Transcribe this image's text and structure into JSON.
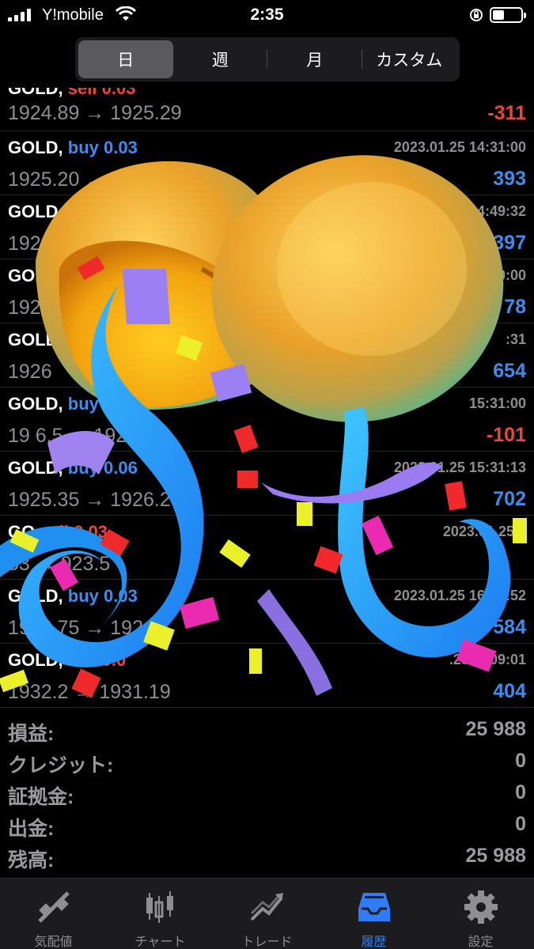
{
  "status_bar": {
    "carrier": "Y!mobile",
    "time": "2:35"
  },
  "periods": [
    {
      "label": "日",
      "active": true
    },
    {
      "label": "週",
      "active": false
    },
    {
      "label": "月",
      "active": false
    },
    {
      "label": "カスタム",
      "active": false
    }
  ],
  "deals": [
    {
      "symbol": "GOLD,",
      "side": "sell",
      "volume": "0.03",
      "time": "",
      "open_price": "1924.89",
      "close_price": "1925.29",
      "arrow": "→",
      "profit": "-311"
    },
    {
      "symbol": "GOLD,",
      "side": "buy",
      "volume": "0.03",
      "time": "2023.01.25 14:31:00",
      "open_price": "1925.20",
      "close_price": "",
      "arrow": "→",
      "profit": "393"
    },
    {
      "symbol": "GOLD,",
      "side": "",
      "volume": "",
      "time": "14:49:32",
      "open_price": "192",
      "close_price": "",
      "arrow": "",
      "profit": "397"
    },
    {
      "symbol": "GOL",
      "side": "",
      "volume": "",
      "time": "0:00",
      "open_price": "192",
      "close_price": "",
      "arrow": "",
      "profit": "78"
    },
    {
      "symbol": "GOLD",
      "side": "",
      "volume": "",
      "time": ":31",
      "open_price": "1926",
      "close_price": "",
      "arrow": "",
      "profit": "654"
    },
    {
      "symbol": "GOLD,",
      "side": "buy",
      "volume": "",
      "time": "15:31:00",
      "open_price": "19 6.5",
      "close_price": "1926.25",
      "arrow": "→",
      "profit": "-101"
    },
    {
      "symbol": "GOLD,",
      "side": "buy",
      "volume": "0.06",
      "time": "2023.01.25 15:31:13",
      "open_price": "1925.35",
      "close_price": "1926.2",
      "arrow": "→",
      "profit": "702"
    },
    {
      "symbol": "GO",
      "side": "sell",
      "volume": "0.03",
      "time": "2023.01.25 1",
      "open_price": "53",
      "close_price": "923.5",
      "arrow": "→",
      "profit": ""
    },
    {
      "symbol": "GOLD,",
      "side": "buy",
      "volume": "0.03",
      "time": "2023.01.25 16:15:52",
      "open_price": "1926.75",
      "close_price": "192",
      "arrow": "→",
      "profit": "584"
    },
    {
      "symbol": "GOLD,",
      "side": "sell",
      "volume": "0.0",
      "time": ".25 1 :09:01",
      "open_price": "1932.2",
      "close_price": "1931.19",
      "arrow": "→",
      "profit": "404"
    }
  ],
  "summary": [
    {
      "label": "損益:",
      "value": "25 988"
    },
    {
      "label": "クレジット:",
      "value": "0"
    },
    {
      "label": "証拠金:",
      "value": "0"
    },
    {
      "label": "出金:",
      "value": "0"
    },
    {
      "label": "残高:",
      "value": "25 988"
    }
  ],
  "tabs": [
    {
      "label": "気配値",
      "icon": "quotes-icon",
      "active": false
    },
    {
      "label": "チャート",
      "icon": "chart-icon",
      "active": false
    },
    {
      "label": "トレード",
      "icon": "trade-icon",
      "active": false
    },
    {
      "label": "履歴",
      "icon": "history-icon",
      "active": true
    },
    {
      "label": "設定",
      "icon": "settings-icon",
      "active": false
    }
  ],
  "colors": {
    "buy": "#3b8df0",
    "sell": "#f0433b",
    "active_tab": "#2f7cf6"
  }
}
